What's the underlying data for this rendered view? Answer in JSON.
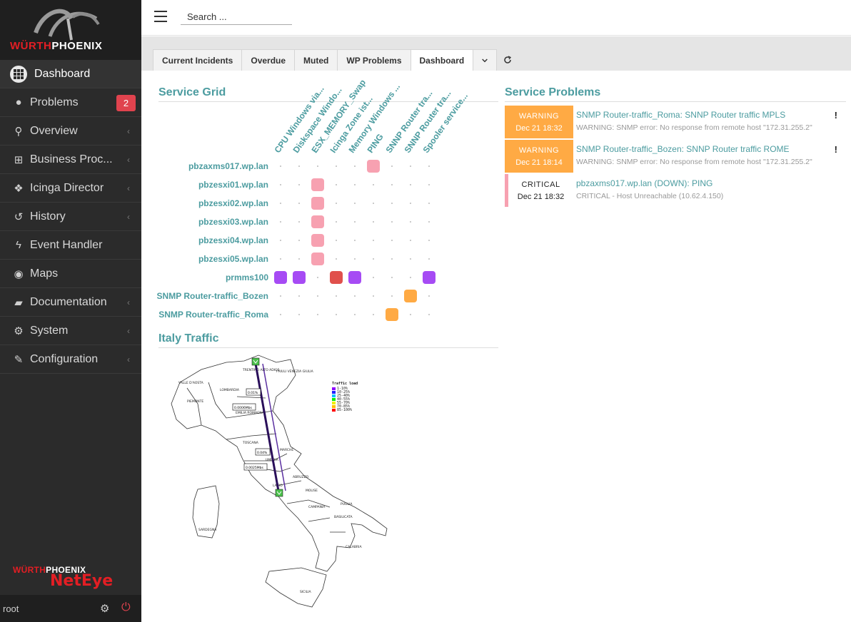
{
  "sidebar": {
    "brand_w": "WÜRTH",
    "brand_p": "PHOENIX",
    "items": [
      {
        "label": "Dashboard",
        "icon": "dashboard-icon",
        "active": true
      },
      {
        "label": "Problems",
        "icon": "exclamation-icon",
        "badge": "2"
      },
      {
        "label": "Overview",
        "icon": "binoculars-icon"
      },
      {
        "label": "Business Proc...",
        "icon": "sitemap-icon"
      },
      {
        "label": "Icinga Director",
        "icon": "cubes-icon"
      },
      {
        "label": "History",
        "icon": "history-icon"
      },
      {
        "label": "Event Handler",
        "icon": "bolt-icon"
      },
      {
        "label": "Maps",
        "icon": "globe-icon"
      },
      {
        "label": "Documentation",
        "icon": "book-icon"
      },
      {
        "label": "System",
        "icon": "cogs-icon"
      },
      {
        "label": "Configuration",
        "icon": "wrench-icon"
      }
    ],
    "footer_brand_w": "WÜRTH",
    "footer_brand_p": "PHOENIX",
    "footer_product": "NetEye",
    "user": "root"
  },
  "topbar": {
    "search_placeholder": "Search ..."
  },
  "tabs": [
    {
      "label": "Current Incidents"
    },
    {
      "label": "Overdue"
    },
    {
      "label": "Muted"
    },
    {
      "label": "WP Problems"
    },
    {
      "label": "Dashboard",
      "active": true
    }
  ],
  "service_grid": {
    "title": "Service Grid",
    "columns": [
      "CPU Windows via...",
      "Diskspace Windo...",
      "ESX_MEMORY_Swap",
      "Icinga Zone ist...",
      "Memory Windows ...",
      "PING",
      "SNNP Router tra...",
      "SNNP Router tra...",
      "Spooler service..."
    ],
    "rows": [
      {
        "host": "pbzaxms017.wp.lan",
        "cells": [
          "",
          "",
          "",
          "",
          "",
          "critical-soft",
          "",
          "",
          ""
        ]
      },
      {
        "host": "pbzesxi01.wp.lan",
        "cells": [
          "",
          "",
          "critical-soft",
          "",
          "",
          "",
          "",
          "",
          ""
        ]
      },
      {
        "host": "pbzesxi02.wp.lan",
        "cells": [
          "",
          "",
          "critical-soft",
          "",
          "",
          "",
          "",
          "",
          ""
        ]
      },
      {
        "host": "pbzesxi03.wp.lan",
        "cells": [
          "",
          "",
          "critical-soft",
          "",
          "",
          "",
          "",
          "",
          ""
        ]
      },
      {
        "host": "pbzesxi04.wp.lan",
        "cells": [
          "",
          "",
          "critical-soft",
          "",
          "",
          "",
          "",
          "",
          ""
        ]
      },
      {
        "host": "pbzesxi05.wp.lan",
        "cells": [
          "",
          "",
          "critical-soft",
          "",
          "",
          "",
          "",
          "",
          ""
        ]
      },
      {
        "host": "prmms100",
        "cells": [
          "unknown",
          "unknown",
          "",
          "critical",
          "unknown",
          "",
          "",
          "",
          "unknown"
        ]
      },
      {
        "host": "SNMP Router-traffic_Bozen",
        "cells": [
          "",
          "",
          "",
          "",
          "",
          "",
          "",
          "warning",
          ""
        ]
      },
      {
        "host": "SNMP Router-traffic_Roma",
        "cells": [
          "",
          "",
          "",
          "",
          "",
          "",
          "warning",
          "",
          ""
        ]
      }
    ],
    "colors": {
      "critical-soft": "#f7a1b1",
      "critical": "#e0504c",
      "unknown": "#a64bf4",
      "warning": "#ffaa44"
    }
  },
  "service_problems": {
    "title": "Service Problems",
    "items": [
      {
        "state": "WARNING",
        "time": "Dec 21 18:32",
        "title": "SNMP Router-traffic_Roma: SNNP Router traffic MPLS",
        "output": "WARNING: SNMP error: No response from remote host \"172.31.255.2\"",
        "flag": "!",
        "kind": "warning"
      },
      {
        "state": "WARNING",
        "time": "Dec 21 18:14",
        "title": "SNMP Router-traffic_Bozen: SNNP Router traffic ROME",
        "output": "WARNING: SNMP error: No response from remote host \"172.31.255.2\"",
        "flag": "!",
        "kind": "warning"
      },
      {
        "state": "CRITICAL",
        "time": "Dec 21 18:32",
        "title": "pbzaxms017.wp.lan (DOWN): PING",
        "output": "CRITICAL - Host Unreachable (10.62.4.150)",
        "flag": "",
        "kind": "critical"
      }
    ],
    "colors": {
      "warning": "#ffaa44",
      "critical": "#f7a1b1"
    }
  },
  "italy_traffic": {
    "title": "Italy Traffic",
    "regions": [
      "TRENTINO ALTO ADIGE",
      "FRIULI VENEZIA GIULIA",
      "VALLE D'AOSTA",
      "LOMBARDIA",
      "PIEMONTE",
      "EMILIA ROMAGNA",
      "TOSCANA",
      "MARCHE",
      "UMBRIA",
      "ABRUZZO",
      "LAZIO",
      "MOLISE",
      "CAMPANIA",
      "PUGLIA",
      "BASILICATA",
      "SARDEGNA",
      "CALABRIA",
      "SICILIA"
    ],
    "link_labels": [
      "0.01%",
      "0.0006Mbs",
      "0.04%",
      "0.0025Mbs"
    ],
    "legend_title": "Traffic load",
    "legend": [
      {
        "label": "1-10%",
        "color": "#8c00ff"
      },
      {
        "label": "10-25%",
        "color": "#2020ff"
      },
      {
        "label": "25-40%",
        "color": "#00c0ff"
      },
      {
        "label": "40-55%",
        "color": "#00f000"
      },
      {
        "label": "55-70%",
        "color": "#f0f000"
      },
      {
        "label": "70-85%",
        "color": "#ffc000"
      },
      {
        "label": "85-100%",
        "color": "#ff0000"
      }
    ]
  }
}
